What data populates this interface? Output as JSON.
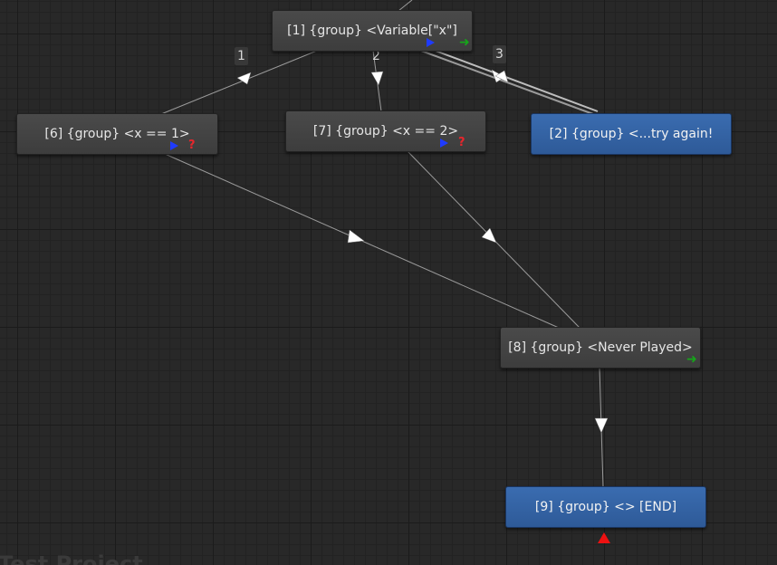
{
  "graph": {
    "nodes": {
      "n1": {
        "label": "[1] {group} <Variable[\"x\"]"
      },
      "n6": {
        "label": "[6] {group} <x == 1>"
      },
      "n7": {
        "label": "[7] {group} <x == 2>"
      },
      "n2": {
        "label": "[2] {group} <...try again!"
      },
      "n8": {
        "label": "[8] {group} <Never Played>"
      },
      "n9": {
        "label": "[9] {group} <> [END]"
      }
    },
    "edge_labels": {
      "e1": "1",
      "e2": "2",
      "e3": "3"
    }
  },
  "watermark": "Test Project",
  "colors": {
    "canvas_bg": "#282828",
    "node_dark": "#444444",
    "node_blue": "#3565a5",
    "edge": "#9a9a9a",
    "input_port_blue": "#1f3bff",
    "output_port_green": "#16a51a",
    "condition_red": "#e8262c"
  },
  "icons": {
    "input_port": "blue-play-triangle-icon",
    "output_port": "green-arrow-icon",
    "condition": "red-question-icon",
    "end_marker": "red-up-triangle-icon"
  }
}
